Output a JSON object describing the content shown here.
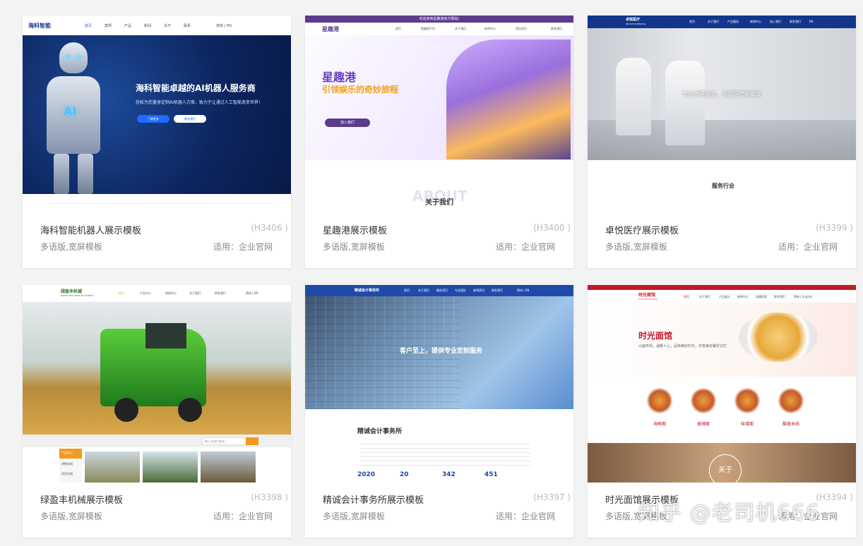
{
  "cards": [
    {
      "name": "海科智能机器人展示模板",
      "code": "(H3406 )",
      "tags": "多语版,宽屏模板",
      "use": "适用：企业官网",
      "preview": {
        "logo": "海科智能",
        "nav": [
          "首页",
          "案例",
          "产品",
          "新闻",
          "关于",
          "联系"
        ],
        "lang": "简体 | EN",
        "headline": "海科智能卓越的AI机器人服务商",
        "subline": "轻松为您量身定制AI机器人方案，致力于让通过人工智能改变世界！",
        "btn1": "了解更多",
        "btn2": "联系我们",
        "robot_label": "AI"
      }
    },
    {
      "name": "星趣港展示模板",
      "code": "(H3400 )",
      "tags": "多语版,宽屏模板",
      "use": "适用：企业官网",
      "preview": {
        "topbar": "欢迎来到星趣港官方网站!",
        "lang": "语言 ▾",
        "logo": "星趣港",
        "nav": [
          "首页",
          "星趣港介绍",
          "关于我们",
          "新闻中心",
          "游玩项目",
          "联系我们"
        ],
        "headline": "星趣港",
        "subline": "引领娱乐的奇妙旅程",
        "btn": "加入我们",
        "about_big": "ABOUT",
        "about_small": "关于我们"
      }
    },
    {
      "name": "卓悦医疗展示模板",
      "code": "(H3399 )",
      "tags": "多语版,宽屏模板",
      "use": "适用：企业官网",
      "preview": {
        "logo": "卓悦医疗",
        "logo_en": "ZHUOYUE MEDICAL",
        "nav": [
          "首页",
          "关于我们",
          "产品服务",
          "新闻中心",
          "加入我们",
          "联系我们",
          "EN"
        ],
        "headline": "专注卓越服务，引领医疗新高度",
        "section": "服务行业"
      }
    },
    {
      "name": "绿盈丰机械展示模板",
      "code": "(H3398 )",
      "tags": "多语版,宽屏模板",
      "use": "适用：企业官网",
      "preview": {
        "logo": "绿盈丰机械",
        "logo_en": "GREEN YING FENG MACHINERY",
        "nav": [
          "首页",
          "产品中心",
          "新闻中心",
          "关于我们",
          "联系我们"
        ],
        "lang": "简体 | EN",
        "search_placeholder": "输入关键字查询",
        "side": [
          "产品中心",
          "耕整机械",
          "收获机械"
        ]
      }
    },
    {
      "name": "精诚会计事务所展示模板",
      "code": "(H3397 )",
      "tags": "多语版,宽屏模板",
      "use": "适用：企业官网",
      "preview": {
        "logo": "精诚会计事务所",
        "nav": [
          "首页",
          "关于我们",
          "服务项目",
          "专业团队",
          "新闻资讯",
          "联系我们"
        ],
        "lang": "简体 | EN",
        "headline": "客户至上，提供专业定制服务",
        "section": "精诚会计事务所",
        "stats": [
          "2020",
          "20",
          "342",
          "451"
        ]
      }
    },
    {
      "name": "时光面馆展示模板",
      "code": "(H3394 )",
      "tags": "多语版,宽屏模板",
      "use": "适用：企业官网",
      "preview": {
        "logo": "时光面馆",
        "logo_en": "Time Noodle Shop",
        "nav": [
          "首页",
          "关于我们",
          "产品展示",
          "新闻中心",
          "加盟招商",
          "联系我们"
        ],
        "lang": "简体 | English",
        "headline": "时光面馆",
        "subline": "以面传情，温暖人心，品味美好时光，共筑美好餐饮记忆",
        "dishes": [
          "海鲜面",
          "香辣面",
          "味增面",
          "酸香米线"
        ],
        "about": "关于"
      }
    }
  ],
  "watermark": "知乎 @老司机666"
}
